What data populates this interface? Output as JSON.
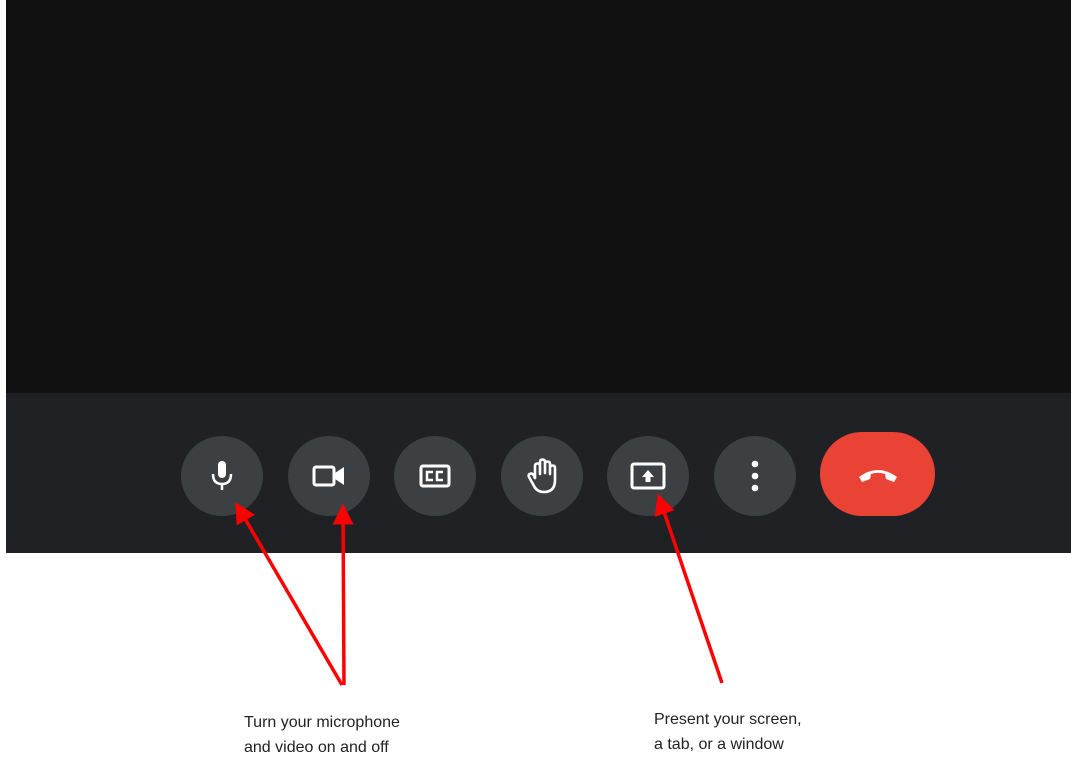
{
  "colors": {
    "video_background": "#111111",
    "toolbar_background": "#202124",
    "button_background": "#3c4043",
    "icon_color": "#ffffff",
    "end_call": "#ea4335",
    "arrow": "#ff0000"
  },
  "toolbar": {
    "buttons": [
      {
        "icon": "microphone-icon"
      },
      {
        "icon": "camera-icon"
      },
      {
        "icon": "closed-captions-icon"
      },
      {
        "icon": "raise-hand-icon"
      },
      {
        "icon": "present-screen-icon"
      },
      {
        "icon": "more-options-icon"
      },
      {
        "icon": "end-call-icon"
      }
    ]
  },
  "annotations": {
    "mic_video": {
      "line1": "Turn your microphone",
      "line2": "and video on and off"
    },
    "present": {
      "line1": "Present your screen,",
      "line2": "a tab, or a window"
    }
  }
}
